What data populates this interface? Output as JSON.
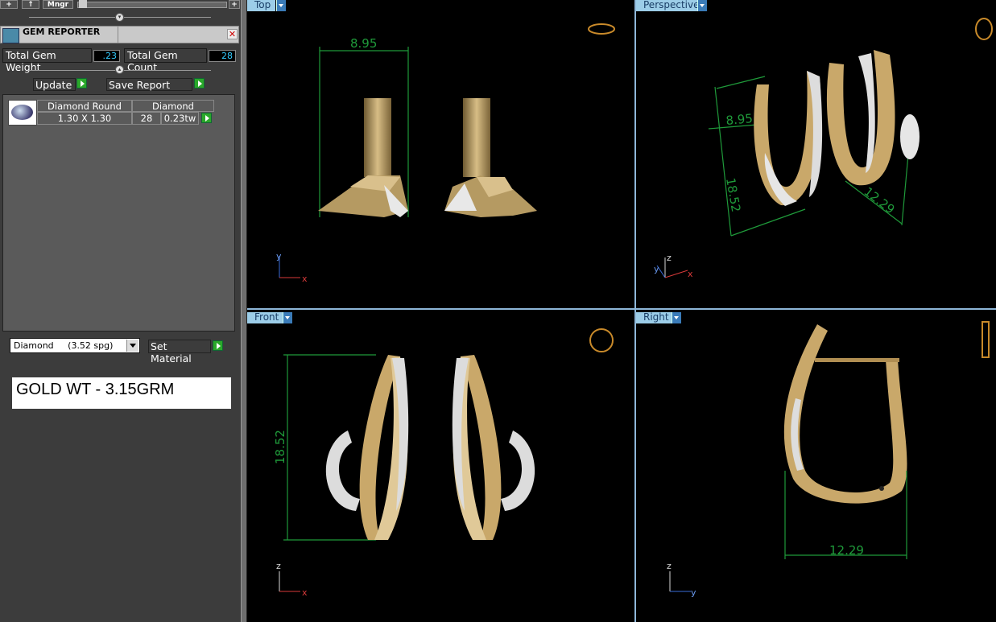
{
  "toolbar": {
    "add_label": "+",
    "up_label": "↑",
    "mngr_label": "Mngr",
    "plus_label": "+"
  },
  "gem_reporter": {
    "title": "GEM REPORTER",
    "total_weight_label": "Total Gem Weight",
    "total_weight_value": ".23",
    "total_count_label": "Total Gem Count",
    "total_count_value": "28",
    "update_label": "Update",
    "save_label": "Save Report",
    "table": {
      "headers": [
        "Diamond Round",
        "Diamond"
      ],
      "row": {
        "size": "1.30 X 1.30",
        "count": "28",
        "weight": "0.23tw"
      }
    }
  },
  "material": {
    "selected": "Diamond     (3.52 spg)",
    "set_label": "Set Material"
  },
  "note": "GOLD WT - 3.15GRM",
  "viewports": {
    "top": {
      "tab": "Top",
      "dimension": "8.95",
      "axis_v": "y",
      "axis_h": "x"
    },
    "perspective": {
      "tab": "Perspective",
      "dimension_a": "18.52",
      "dimension_b": "12.29",
      "dimension_c": "8.95",
      "axis_v": "z",
      "axis_h": "x",
      "axis_d": "y"
    },
    "front": {
      "tab": "Front",
      "dimension": "18.52",
      "axis_v": "z",
      "axis_h": "x"
    },
    "right": {
      "tab": "Right",
      "dimension": "12.29",
      "axis_v": "z",
      "axis_h": "y"
    }
  },
  "colors": {
    "dimension": "#1f9a3a",
    "gold": "#c9a86a",
    "viewport_tab": "#9ccde8"
  },
  "icons": [
    "gem-icon",
    "close-icon",
    "play-arrow-icon",
    "ring-icon",
    "dropdown-arrow-icon"
  ]
}
